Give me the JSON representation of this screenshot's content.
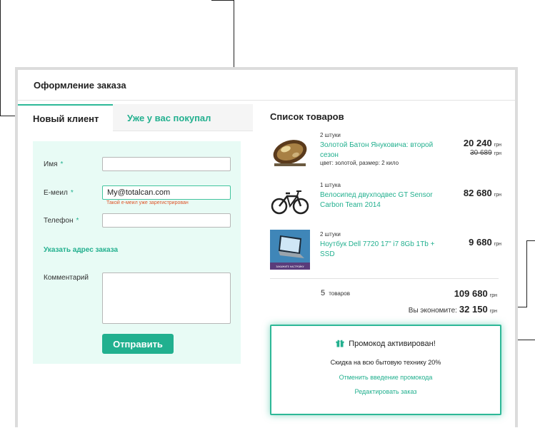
{
  "page": {
    "title": "Оформление заказа"
  },
  "tabs": {
    "new_client": "Новый клиент",
    "returning": "Уже у вас покупал"
  },
  "form": {
    "name_label": "Имя",
    "email_label": "Е-меил",
    "phone_label": "Телефон",
    "required_mark": "*",
    "name_value": "",
    "email_value": "My@totalcan.com",
    "phone_value": "",
    "email_error": "Такой е-меил уже зарегистрирован",
    "address_link": "Указать адрес заказа",
    "comment_label": "Комментарий",
    "submit": "Отправить"
  },
  "products": {
    "title": "Список товаров",
    "currency": "грн",
    "items": [
      {
        "qty": "2 штуки",
        "name": "Золотой Батон Януковича: второй сезон",
        "meta": "цвет: золотой, размер: 2 кило",
        "price": "20 240",
        "old_price": "30 689"
      },
      {
        "qty": "1 штука",
        "name": "Велосипед двухподвес GT Sensor Carbon Team 2014",
        "price": "82 680"
      },
      {
        "qty": "2 штуки",
        "name": "Ноутбук Dell 7720 17\" i7 8Gb 1Tb + SSD",
        "price": "9 680",
        "thumb_caption": "ЗАКАЖИТЕ НАСТРОЙКУ"
      }
    ],
    "count": "5",
    "count_unit": "товаров",
    "total": "109 680",
    "save_label": "Вы экономите:",
    "save_value": "32 150"
  },
  "promo": {
    "title": "Промокод активирован!",
    "description": "Скидка на всю бытовую технику 20%",
    "cancel_link": "Отменить введение промокода",
    "edit_link": "Редактировать заказ",
    "icon": "gift-icon"
  },
  "colors": {
    "accent": "#23b08f",
    "error": "#e0562a",
    "panel": "#e8fbf5",
    "frame": "#dcdcdc"
  }
}
